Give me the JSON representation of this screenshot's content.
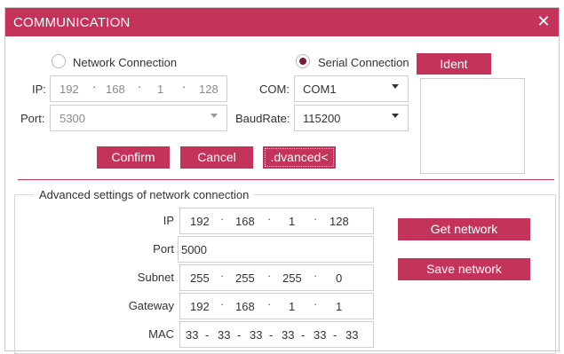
{
  "window": {
    "title": "COMMUNICATION",
    "close_glyph": "✕"
  },
  "connection": {
    "network_label": "Network Connection",
    "serial_label": "Serial Connection",
    "ident_label": "Ident",
    "ip_label": "IP:",
    "ip": [
      "192",
      "168",
      "1",
      "128"
    ],
    "port_label": "Port:",
    "port_value": "5300",
    "com_label": "COM:",
    "com_value": "COM1",
    "baud_label": "BaudRate:",
    "baud_value": "115200",
    "selected": "serial"
  },
  "buttons": {
    "confirm": "Confirm",
    "cancel": "Cancel",
    "advanced": ".dvanced<"
  },
  "advanced": {
    "title": "Advanced settings of network connection",
    "ip_label": "IP",
    "ip": [
      "192",
      "168",
      "1",
      "128"
    ],
    "port_label": "Port",
    "port_value": "5000",
    "subnet_label": "Subnet",
    "subnet": [
      "255",
      "255",
      "255",
      "0"
    ],
    "gateway_label": "Gateway",
    "gateway": [
      "192",
      "168",
      "1",
      "1"
    ],
    "mac_label": "MAC",
    "mac": [
      "33",
      "33",
      "33",
      "33",
      "33",
      "33"
    ],
    "get_network": "Get network",
    "save_network": "Save network"
  },
  "colors": {
    "accent": "#c4335a",
    "radio_dot": "#7a1f33"
  }
}
